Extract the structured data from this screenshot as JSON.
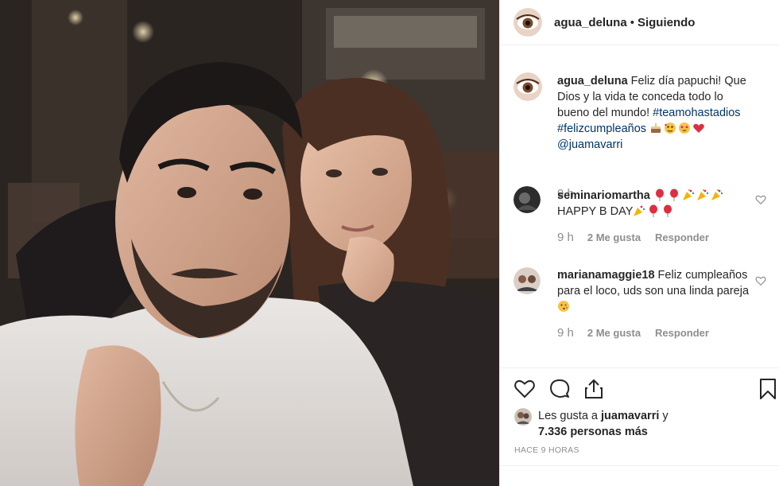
{
  "post": {
    "author": "agua_deluna",
    "separator": "•",
    "follow_status": "Siguiendo"
  },
  "caption": {
    "user": "agua_deluna",
    "text": "Feliz día papuchi! Que Dios y la vida te conceda todo lo bueno del mundo!",
    "hashtag1": "#teamohastadios",
    "hashtag2": "#felizcumpleaños",
    "mention": "@juamavarri",
    "emojis": [
      "cake-emoji",
      "hearts-face-emoji",
      "star-eyes-emoji",
      "red-heart-emoji"
    ],
    "time": "9 h"
  },
  "comments": [
    {
      "user": "seminariomartha",
      "text": "HAPPY B DAY",
      "emojis_lead": [
        "balloon-emoji",
        "balloon-emoji",
        "party-popper-emoji",
        "party-popper-emoji",
        "party-popper-emoji"
      ],
      "emojis_trail": [
        "party-popper-emoji",
        "balloon-emoji",
        "balloon-emoji"
      ],
      "time": "9 h",
      "likes": "2 Me gusta",
      "reply": "Responder"
    },
    {
      "user": "marianamaggie18",
      "text": "Feliz cumpleaños para el loco, uds son una linda pareja",
      "emojis_trail": [
        "kiss-face-emoji"
      ],
      "time": "9 h",
      "likes": "2 Me gusta",
      "reply": "Responder"
    }
  ],
  "likes": {
    "prefix": "Les gusta a",
    "user": "juamavarri",
    "conj": "y",
    "count": "7.336 personas más"
  },
  "time_ago": "HACE 9 HORAS",
  "icons": [
    "heart-icon",
    "comment-icon",
    "share-icon",
    "bookmark-icon"
  ],
  "colors": {
    "link": "#003569",
    "muted": "#8e8e8e",
    "border": "#efefef"
  }
}
